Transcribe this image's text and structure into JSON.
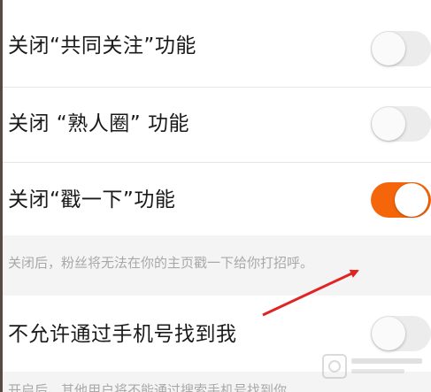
{
  "settings": {
    "items": [
      {
        "label": "关闭“共同关注”功能",
        "enabled": false
      },
      {
        "label": "关闭 “熟人圈” 功能",
        "enabled": false
      },
      {
        "label": "关闭“戳一下”功能",
        "enabled": true
      },
      {
        "label": "不允许通过手机号找到我",
        "enabled": false
      }
    ],
    "notes": [
      "关闭后，粉丝将无法在你的主页戳一下给你打招呼。",
      "开启后，其他用户将不能通过搜索手机号找到你"
    ]
  },
  "colors": {
    "toggle_on": "#f5660b",
    "toggle_off": "#ececec",
    "annotation_arrow": "#e02424",
    "note_background": "#f4f4f4"
  }
}
